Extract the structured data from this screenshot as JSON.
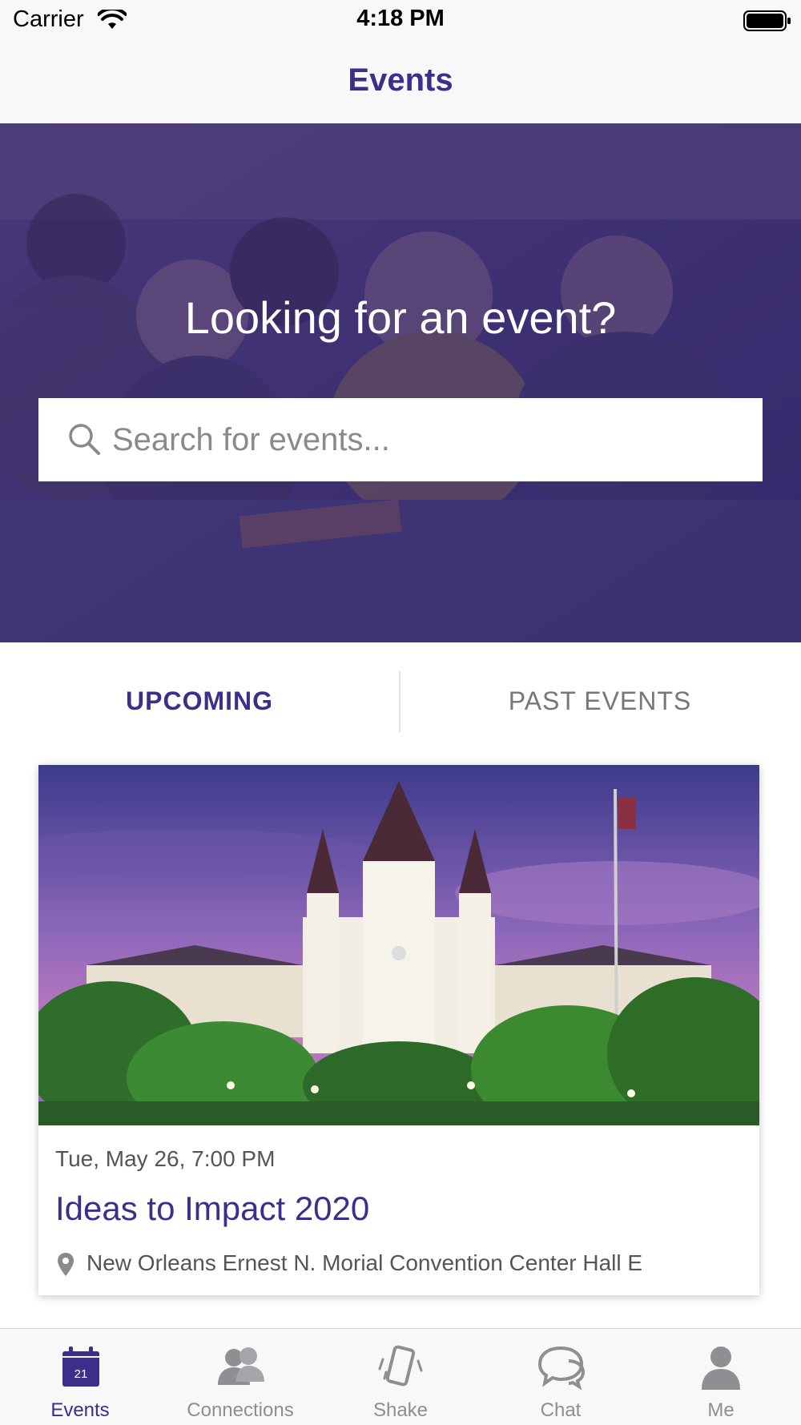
{
  "status_bar": {
    "carrier": "Carrier",
    "time": "4:18 PM"
  },
  "nav": {
    "title": "Events"
  },
  "hero": {
    "headline": "Looking for an event?",
    "search_placeholder": "Search for events..."
  },
  "tabs": {
    "upcoming": "UPCOMING",
    "past": "PAST EVENTS",
    "selected": "upcoming"
  },
  "event": {
    "date": "Tue, May 26, 7:00 PM",
    "title": "Ideas to Impact 2020",
    "location": "New Orleans Ernest N. Morial Convention Center Hall E"
  },
  "tab_bar": {
    "items": [
      {
        "label": "Events",
        "icon": "calendar-icon",
        "icon_text": "21",
        "active": true
      },
      {
        "label": "Connections",
        "icon": "people-icon"
      },
      {
        "label": "Shake",
        "icon": "phone-shake-icon"
      },
      {
        "label": "Chat",
        "icon": "chat-bubbles-icon"
      },
      {
        "label": "Me",
        "icon": "person-icon"
      }
    ]
  },
  "colors": {
    "brand": "#3c2e8a",
    "inactive": "#8e8e93"
  }
}
